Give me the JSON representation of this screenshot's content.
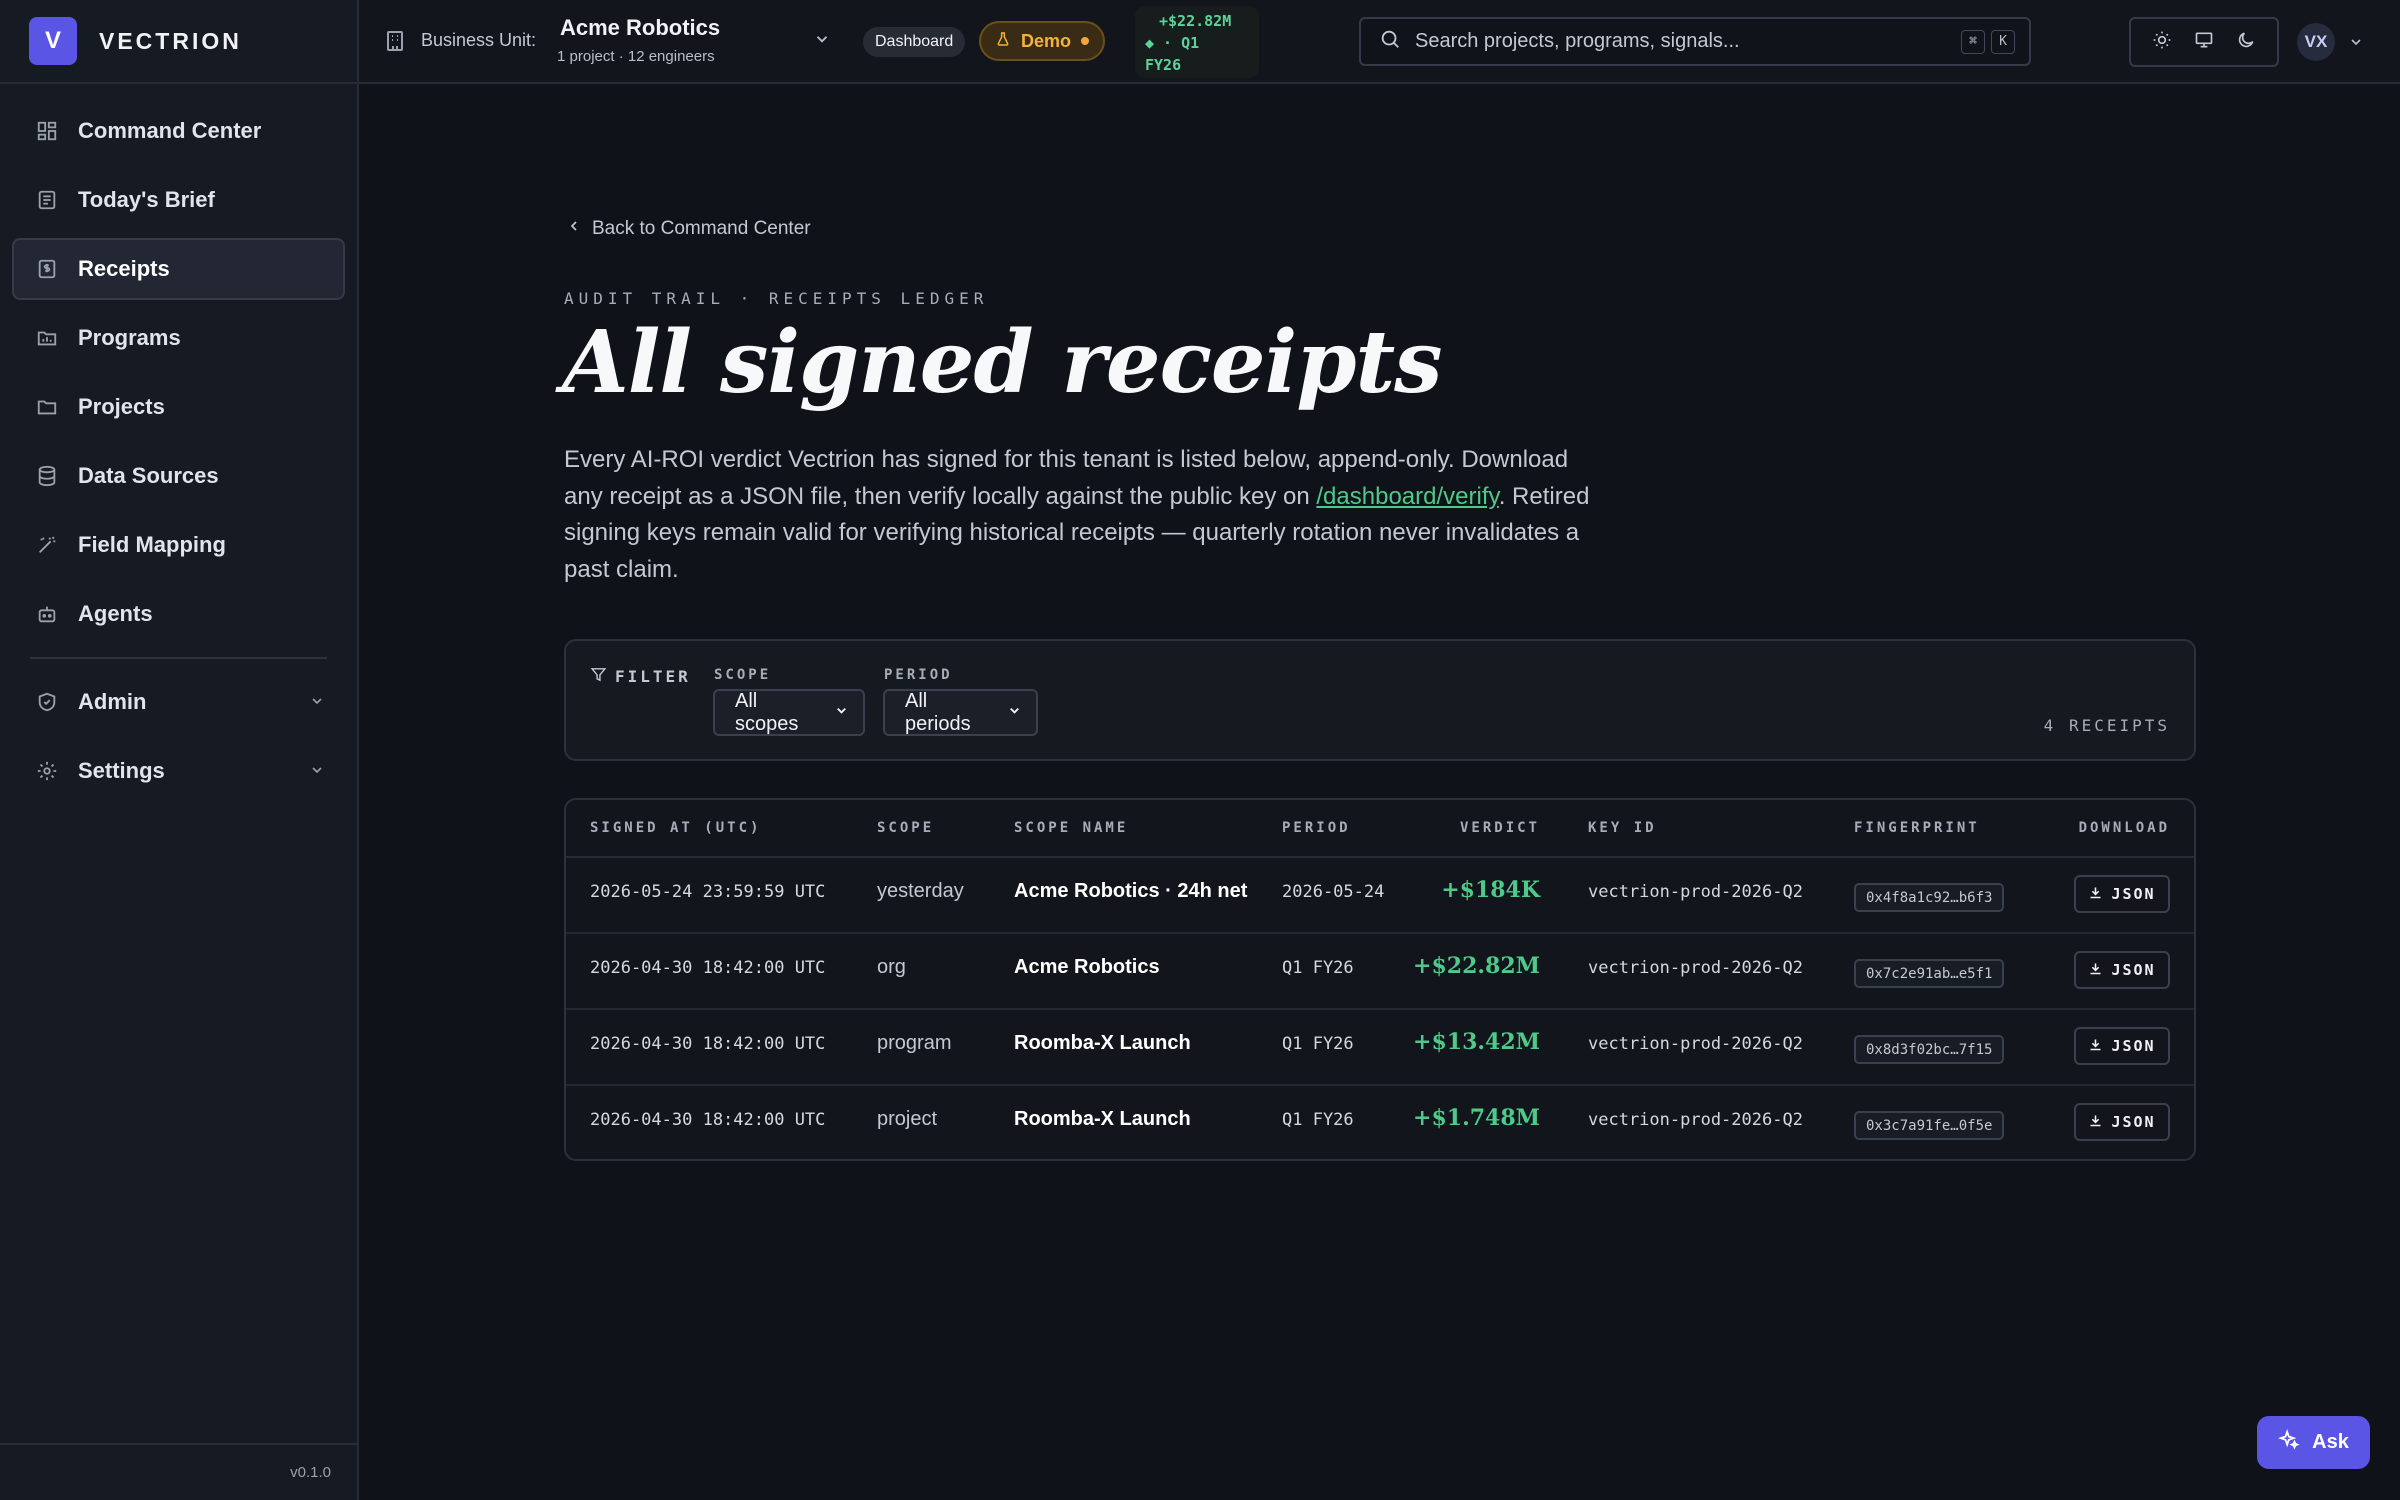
{
  "brand": {
    "logo_letter": "V",
    "name": "VECTRION",
    "accent": "#5b55e6"
  },
  "sidebar": {
    "items": [
      {
        "label": "Command Center",
        "icon": "dashboard-grid-icon"
      },
      {
        "label": "Today's Brief",
        "icon": "newspaper-icon"
      },
      {
        "label": "Receipts",
        "icon": "receipt-dollar-icon",
        "active": true
      },
      {
        "label": "Programs",
        "icon": "chart-folder-icon"
      },
      {
        "label": "Projects",
        "icon": "folder-icon"
      },
      {
        "label": "Data Sources",
        "icon": "database-icon"
      },
      {
        "label": "Field Mapping",
        "icon": "wand-icon"
      },
      {
        "label": "Agents",
        "icon": "bot-icon"
      }
    ],
    "admin_items": [
      {
        "label": "Admin",
        "icon": "shield-icon"
      },
      {
        "label": "Settings",
        "icon": "gear-icon"
      }
    ],
    "version": "v0.1.0"
  },
  "topbar": {
    "bu_label": "Business Unit:",
    "bu_name": "Acme Robotics",
    "bu_sub": "1 project · 12 engineers",
    "dashboard_pill": "Dashboard",
    "demo_pill": "Demo",
    "ticker": "+$22.82M ◆ · Q1 FY26",
    "ticker_line1": "+$22.82M",
    "ticker_line2": "◆ · Q1",
    "ticker_line3": "FY26",
    "search_placeholder": "Search projects, programs, signals...",
    "kbd_cmd": "⌘",
    "kbd_k": "K",
    "avatar": "VX"
  },
  "page": {
    "back_label": "Back to Command Center",
    "eyebrow": "AUDIT TRAIL · RECEIPTS LEDGER",
    "title": "All signed receipts",
    "intro_part1": "Every AI-ROI verdict Vectrion has signed for this tenant is listed below, append-only. Download any receipt as a JSON file, then verify locally against the public key on ",
    "intro_link": "/dashboard/verify",
    "intro_part2": ". Retired signing keys remain valid for verifying historical receipts — quarterly rotation never invalidates a past claim."
  },
  "filter": {
    "label": "FILTER",
    "scope_label": "SCOPE",
    "scope_value": "All scopes",
    "period_label": "PERIOD",
    "period_value": "All periods",
    "count": "4 RECEIPTS"
  },
  "table": {
    "headers": {
      "signed_at": "SIGNED AT (UTC)",
      "scope": "SCOPE",
      "scope_name": "SCOPE NAME",
      "period": "PERIOD",
      "verdict": "VERDICT",
      "key_id": "KEY ID",
      "fingerprint": "FINGERPRINT",
      "download": "DOWNLOAD"
    },
    "rows": [
      {
        "signed_at": "2026-05-24 23:59:59 UTC",
        "scope": "yesterday",
        "scope_name": "Acme Robotics · 24h net",
        "period": "2026-05-24",
        "verdict": "+$184K",
        "key_id": "vectrion-prod-2026-Q2",
        "fingerprint": "0x4f8a1c92…b6f3",
        "download": "JSON"
      },
      {
        "signed_at": "2026-04-30 18:42:00 UTC",
        "scope": "org",
        "scope_name": "Acme Robotics",
        "period": "Q1 FY26",
        "verdict": "+$22.82M",
        "key_id": "vectrion-prod-2026-Q2",
        "fingerprint": "0x7c2e91ab…e5f1",
        "download": "JSON"
      },
      {
        "signed_at": "2026-04-30 18:42:00 UTC",
        "scope": "program",
        "scope_name": "Roomba-X Launch",
        "period": "Q1 FY26",
        "verdict": "+$13.42M",
        "key_id": "vectrion-prod-2026-Q2",
        "fingerprint": "0x8d3f02bc…7f15",
        "download": "JSON"
      },
      {
        "signed_at": "2026-04-30 18:42:00 UTC",
        "scope": "project",
        "scope_name": "Roomba-X Launch",
        "period": "Q1 FY26",
        "verdict": "+$1.748M",
        "key_id": "vectrion-prod-2026-Q2",
        "fingerprint": "0x3c7a91fe…0f5e",
        "download": "JSON"
      }
    ]
  },
  "ask_button": "Ask",
  "colors": {
    "positive": "#4fc989",
    "demo": "#f2b33d",
    "background": "#0f1218"
  }
}
